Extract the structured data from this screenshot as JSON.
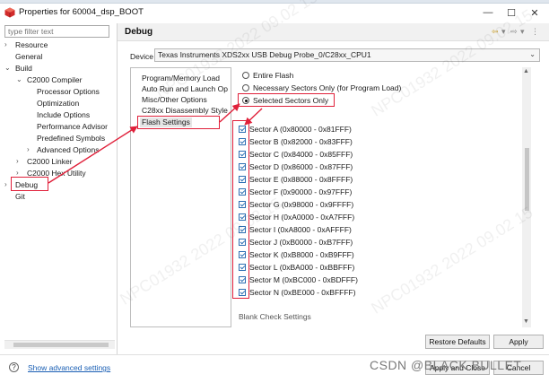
{
  "window": {
    "title": "Properties for 60004_dsp_BOOT",
    "minimize": "—",
    "maximize": "☐",
    "close": "✕"
  },
  "filter": {
    "placeholder": "type filter text"
  },
  "tree": {
    "resource": "Resource",
    "general": "General",
    "build": "Build",
    "c2000_compiler": "C2000 Compiler",
    "processor_options": "Processor Options",
    "optimization": "Optimization",
    "include_options": "Include Options",
    "performance_advisor": "Performance Advisor",
    "predefined_symbols": "Predefined Symbols",
    "advanced_options": "Advanced Options",
    "c2000_linker": "C2000 Linker",
    "c2000_hex_utility": "C2000 Hex Utility",
    "debug": "Debug",
    "git": "Git"
  },
  "header": {
    "title": "Debug"
  },
  "device": {
    "label": "Device",
    "value": "Texas Instruments XDS2xx USB Debug Probe_0/C28xx_CPU1"
  },
  "categories": [
    "Program/Memory Load",
    "Auto Run and Launch Op",
    "Misc/Other Options",
    "C28xx Disassembly Style",
    "Flash Settings"
  ],
  "erase": {
    "entire": "Entire Flash",
    "necessary": "Necessary Sectors Only (for Program Load)",
    "selected": "Selected Sectors Only",
    "selected_option": "selected"
  },
  "sectors": [
    "Sector A (0x80000 - 0x81FFF)",
    "Sector B (0x82000 - 0x83FFF)",
    "Sector C (0x84000 - 0x85FFF)",
    "Sector D (0x86000 - 0x87FFF)",
    "Sector E (0x88000 - 0x8FFFF)",
    "Sector F (0x90000 - 0x97FFF)",
    "Sector G (0x98000 - 0x9FFFF)",
    "Sector H (0xA0000 - 0xA7FFF)",
    "Sector I (0xA8000 - 0xAFFFF)",
    "Sector J (0xB0000 - 0xB7FFF)",
    "Sector K (0xB8000 - 0xB9FFF)",
    "Sector L (0xBA000 - 0xBBFFF)",
    "Sector M (0xBC000 - 0xBDFFF)",
    "Sector N (0xBE000 - 0xBFFFF)"
  ],
  "clipped_text": "Blank Check Settings",
  "buttons": {
    "restore": "Restore Defaults",
    "apply": "Apply",
    "apply_close": "Apply and Close",
    "cancel": "Cancel"
  },
  "footer": {
    "help": "?",
    "advanced": "Show advanced settings",
    "credit": "CSDN @BLACK BULLET"
  },
  "watermark": "NPC01932  2022 09.02 15",
  "colors": {
    "highlight": "#e0203a",
    "link": "#1a5fb4",
    "check": "#2d6fb3"
  }
}
